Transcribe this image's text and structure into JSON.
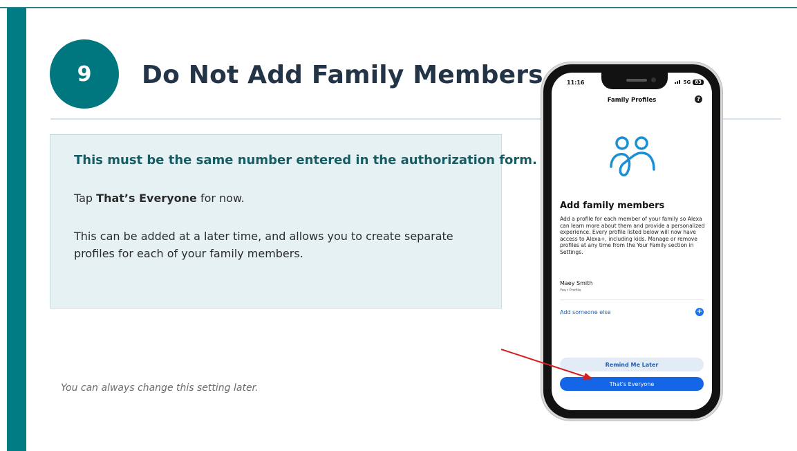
{
  "step": {
    "number": "9",
    "title": "Do Not Add Family Members"
  },
  "info": {
    "heading": "This must be the same number entered in the authorization form.",
    "tap_prefix": "Tap ",
    "tap_bold": "That’s Everyone",
    "tap_suffix": " for now.",
    "paragraph": "This can be added at a later time, and allows you to create separate profiles for each of your family members."
  },
  "footnote": "You can always change this setting later.",
  "phone": {
    "status": {
      "time": "11:16",
      "network": "5G",
      "battery": "83"
    },
    "screen_title": "Family Profiles",
    "help_icon_text": "?",
    "add_title": "Add family members",
    "add_description": "Add a profile for each member of your family so Alexa can learn more about them and provide a personalized experience. Every profile listed below will now have access to Alexa+, including kids. Manage or remove profiles at any time from the Your Family section in Settings.",
    "profile": {
      "name": "Maey Smith",
      "subtitle": "Your Profile"
    },
    "add_someone_label": "Add someone else",
    "plus_icon_text": "+",
    "remind_button": "Remind Me Later",
    "everyone_button": "That's Everyone"
  },
  "colors": {
    "teal_accent": "#007a83",
    "title_text": "#243447",
    "info_box_bg": "#e6f1f3",
    "primary_button": "#1466e6",
    "arrow": "#d62020"
  }
}
